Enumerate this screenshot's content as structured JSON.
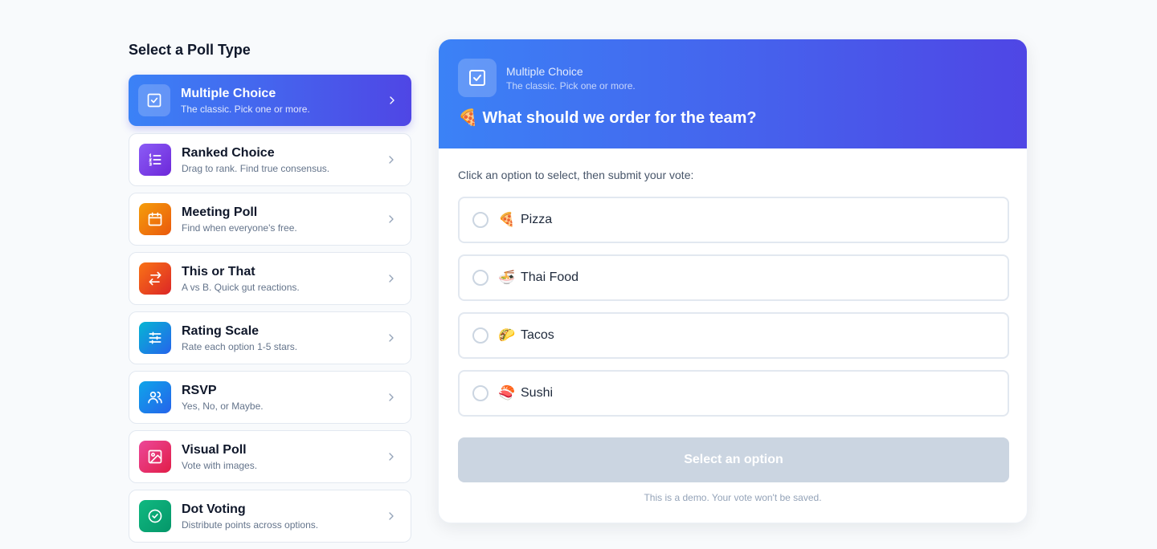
{
  "sidebar": {
    "title": "Select a Poll Type",
    "items": [
      {
        "name": "Multiple Choice",
        "desc": "The classic. Pick one or more.",
        "icon": "checkbox-icon",
        "color": "#3b82f6"
      },
      {
        "name": "Ranked Choice",
        "desc": "Drag to rank. Find true consensus.",
        "icon": "list-ordered-icon",
        "color": "#7c3aed"
      },
      {
        "name": "Meeting Poll",
        "desc": "Find when everyone's free.",
        "icon": "calendar-icon",
        "color": "#f97316"
      },
      {
        "name": "This or That",
        "desc": "A vs B. Quick gut reactions.",
        "icon": "swap-arrows-icon",
        "color": "#ef4444"
      },
      {
        "name": "Rating Scale",
        "desc": "Rate each option 1-5 stars.",
        "icon": "sliders-icon",
        "color": "#0ea5e9"
      },
      {
        "name": "RSVP",
        "desc": "Yes, No, or Maybe.",
        "icon": "users-icon",
        "color": "#3b82f6"
      },
      {
        "name": "Visual Poll",
        "desc": "Vote with images.",
        "icon": "image-icon",
        "color": "#ec4899"
      },
      {
        "name": "Dot Voting",
        "desc": "Distribute points across options.",
        "icon": "check-circle-icon",
        "color": "#10b981"
      }
    ]
  },
  "poll": {
    "type": "Multiple Choice",
    "type_desc": "The classic. Pick one or more.",
    "question": "🍕 What should we order for the team?",
    "instruction": "Click an option to select, then submit your vote:",
    "options": [
      {
        "emoji": "🍕",
        "label": "Pizza"
      },
      {
        "emoji": "🍜",
        "label": "Thai Food"
      },
      {
        "emoji": "🌮",
        "label": "Tacos"
      },
      {
        "emoji": "🍣",
        "label": "Sushi"
      }
    ],
    "submit_label": "Select an option",
    "note": "This is a demo. Your vote won't be saved."
  }
}
